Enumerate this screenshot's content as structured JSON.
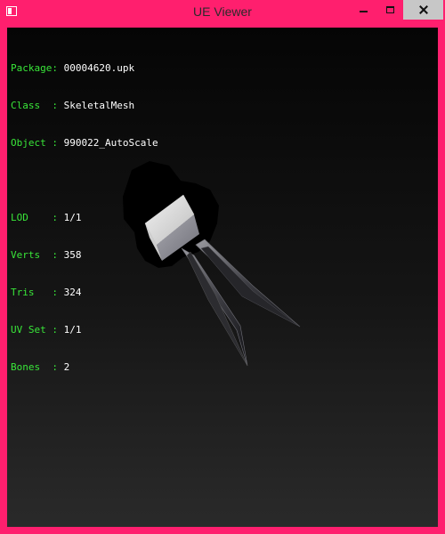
{
  "window": {
    "title": "UE Viewer",
    "app_icon": "window-icon",
    "controls": [
      "minimize-icon",
      "maximize-icon",
      "close-icon"
    ]
  },
  "info": {
    "package": {
      "label": "Package:",
      "value": "00004620.upk"
    },
    "class": {
      "label": "Class  :",
      "value": "SkeletalMesh"
    },
    "object": {
      "label": "Object :",
      "value": "990022_AutoScale"
    },
    "lod": {
      "label": "LOD    :",
      "value": "1/1"
    },
    "verts": {
      "label": "Verts  :",
      "value": "358"
    },
    "tris": {
      "label": "Tris   :",
      "value": "324"
    },
    "uv_set": {
      "label": "UV Set :",
      "value": "1/1"
    },
    "bones": {
      "label": "Bones  :",
      "value": "2"
    }
  },
  "colors": {
    "frame": "#ff1f6e",
    "label_text": "#39e639",
    "value_text": "#ffffff"
  }
}
